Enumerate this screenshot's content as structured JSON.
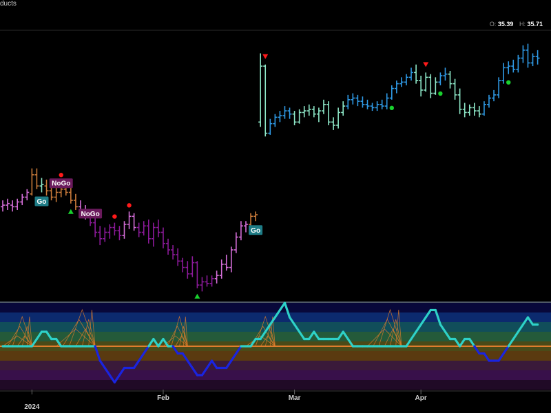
{
  "header": {
    "title_fragment": "ducts",
    "ohlc": [
      {
        "key": "O:",
        "value": "35.39"
      },
      {
        "key": "H:",
        "value": "35.71"
      }
    ]
  },
  "colors": {
    "go_strong": "#2f9ae6",
    "go_weak": "#8ee8c8",
    "nogo_strong": "#8b1a99",
    "nogo_weak": "#d46ed8",
    "amber": "#c97a3a",
    "oscillator_go": "#2ed1c8",
    "oscillator_nogo": "#1a24e0",
    "zero_line": "#e07d2c"
  },
  "chart_data": {
    "type": "bar",
    "title": "",
    "x_ticks": [
      "2024",
      "Feb",
      "Mar",
      "Apr"
    ],
    "tags": [
      {
        "text": "Go",
        "bar": 8
      },
      {
        "text": "NoGo",
        "bar": 12
      },
      {
        "text": "NoGo",
        "bar": 18
      },
      {
        "text": "Go",
        "bar": 52
      }
    ],
    "price_bars": [
      {
        "o": 25.2,
        "h": 25.6,
        "l": 24.9,
        "c": 25.3,
        "s": "nw"
      },
      {
        "o": 25.3,
        "h": 25.7,
        "l": 25.0,
        "c": 25.4,
        "s": "nw"
      },
      {
        "o": 25.3,
        "h": 25.6,
        "l": 24.9,
        "c": 25.2,
        "s": "nw"
      },
      {
        "o": 25.2,
        "h": 25.7,
        "l": 25.0,
        "c": 25.5,
        "s": "nw"
      },
      {
        "o": 25.5,
        "h": 26.0,
        "l": 25.3,
        "c": 25.8,
        "s": "nw"
      },
      {
        "o": 25.8,
        "h": 26.3,
        "l": 25.6,
        "c": 26.1,
        "s": "nw"
      },
      {
        "o": 26.0,
        "h": 27.6,
        "l": 25.9,
        "c": 27.2,
        "s": "a"
      },
      {
        "o": 27.2,
        "h": 27.6,
        "l": 26.3,
        "c": 26.5,
        "s": "a"
      },
      {
        "o": 26.5,
        "h": 27.0,
        "l": 26.1,
        "c": 26.6,
        "s": "gw"
      },
      {
        "o": 26.5,
        "h": 26.9,
        "l": 25.9,
        "c": 26.2,
        "s": "a"
      },
      {
        "o": 26.2,
        "h": 26.6,
        "l": 25.6,
        "c": 25.8,
        "s": "a"
      },
      {
        "o": 25.8,
        "h": 26.4,
        "l": 25.5,
        "c": 26.1,
        "s": "a"
      },
      {
        "o": 26.1,
        "h": 26.8,
        "l": 25.8,
        "c": 26.3,
        "s": "a"
      },
      {
        "o": 26.3,
        "h": 26.6,
        "l": 25.9,
        "c": 26.1,
        "s": "a"
      },
      {
        "o": 26.1,
        "h": 26.4,
        "l": 25.4,
        "c": 25.6,
        "s": "a"
      },
      {
        "o": 25.6,
        "h": 26.0,
        "l": 25.0,
        "c": 25.2,
        "s": "a"
      },
      {
        "o": 25.2,
        "h": 25.6,
        "l": 24.6,
        "c": 24.9,
        "s": "nw"
      },
      {
        "o": 24.9,
        "h": 25.3,
        "l": 24.4,
        "c": 24.6,
        "s": "nw"
      },
      {
        "o": 24.6,
        "h": 24.9,
        "l": 24.0,
        "c": 24.2,
        "s": "ns"
      },
      {
        "o": 24.2,
        "h": 24.6,
        "l": 23.3,
        "c": 23.6,
        "s": "ns"
      },
      {
        "o": 23.6,
        "h": 24.0,
        "l": 22.8,
        "c": 23.2,
        "s": "ns"
      },
      {
        "o": 23.2,
        "h": 23.9,
        "l": 23.0,
        "c": 23.6,
        "s": "ns"
      },
      {
        "o": 23.6,
        "h": 24.1,
        "l": 23.2,
        "c": 23.9,
        "s": "ns"
      },
      {
        "o": 23.9,
        "h": 24.2,
        "l": 23.4,
        "c": 23.7,
        "s": "ns"
      },
      {
        "o": 23.7,
        "h": 24.0,
        "l": 23.1,
        "c": 23.4,
        "s": "ns"
      },
      {
        "o": 23.4,
        "h": 24.3,
        "l": 23.2,
        "c": 24.1,
        "s": "nw"
      },
      {
        "o": 24.1,
        "h": 24.9,
        "l": 23.8,
        "c": 24.6,
        "s": "nw"
      },
      {
        "o": 24.6,
        "h": 24.8,
        "l": 23.7,
        "c": 23.9,
        "s": "nw"
      },
      {
        "o": 23.9,
        "h": 24.2,
        "l": 23.3,
        "c": 23.6,
        "s": "ns"
      },
      {
        "o": 23.6,
        "h": 24.3,
        "l": 23.4,
        "c": 24.0,
        "s": "ns"
      },
      {
        "o": 24.0,
        "h": 24.4,
        "l": 22.9,
        "c": 23.2,
        "s": "ns"
      },
      {
        "o": 23.2,
        "h": 24.2,
        "l": 22.7,
        "c": 23.9,
        "s": "ns"
      },
      {
        "o": 23.9,
        "h": 24.4,
        "l": 23.3,
        "c": 23.6,
        "s": "ns"
      },
      {
        "o": 23.6,
        "h": 23.9,
        "l": 22.6,
        "c": 22.9,
        "s": "ns"
      },
      {
        "o": 22.9,
        "h": 23.2,
        "l": 22.2,
        "c": 22.5,
        "s": "ns"
      },
      {
        "o": 22.5,
        "h": 22.8,
        "l": 21.9,
        "c": 22.2,
        "s": "ns"
      },
      {
        "o": 22.2,
        "h": 22.6,
        "l": 21.5,
        "c": 21.8,
        "s": "ns"
      },
      {
        "o": 21.8,
        "h": 22.0,
        "l": 21.1,
        "c": 21.4,
        "s": "ns"
      },
      {
        "o": 21.4,
        "h": 21.8,
        "l": 20.7,
        "c": 21.0,
        "s": "ns"
      },
      {
        "o": 21.0,
        "h": 22.1,
        "l": 20.8,
        "c": 21.7,
        "s": "ns"
      },
      {
        "o": 21.7,
        "h": 21.8,
        "l": 20.1,
        "c": 20.3,
        "s": "ns"
      },
      {
        "o": 20.3,
        "h": 20.8,
        "l": 19.9,
        "c": 20.5,
        "s": "ns"
      },
      {
        "o": 20.5,
        "h": 20.9,
        "l": 20.2,
        "c": 20.4,
        "s": "ns"
      },
      {
        "o": 20.4,
        "h": 20.9,
        "l": 20.2,
        "c": 20.7,
        "s": "ns"
      },
      {
        "o": 20.7,
        "h": 21.2,
        "l": 20.4,
        "c": 20.9,
        "s": "nw"
      },
      {
        "o": 20.9,
        "h": 21.9,
        "l": 20.7,
        "c": 21.6,
        "s": "nw"
      },
      {
        "o": 21.6,
        "h": 22.2,
        "l": 21.2,
        "c": 21.4,
        "s": "nw"
      },
      {
        "o": 21.4,
        "h": 22.7,
        "l": 21.1,
        "c": 22.5,
        "s": "nw"
      },
      {
        "o": 22.5,
        "h": 23.6,
        "l": 22.3,
        "c": 23.3,
        "s": "nw"
      },
      {
        "o": 23.3,
        "h": 24.3,
        "l": 23.1,
        "c": 24.0,
        "s": "nw"
      },
      {
        "o": 24.0,
        "h": 24.3,
        "l": 23.6,
        "c": 24.1,
        "s": "nw"
      },
      {
        "o": 24.1,
        "h": 24.8,
        "l": 23.9,
        "c": 24.6,
        "s": "a"
      },
      {
        "o": 24.6,
        "h": 24.9,
        "l": 24.3,
        "c": 24.7,
        "s": "a"
      },
      {
        "o": 30.5,
        "h": 34.8,
        "l": 30.2,
        "c": 34.0,
        "s": "gw"
      },
      {
        "o": 34.0,
        "h": 34.1,
        "l": 29.6,
        "c": 29.8,
        "s": "gw"
      },
      {
        "o": 29.8,
        "h": 30.7,
        "l": 29.7,
        "c": 30.4,
        "s": "gs"
      },
      {
        "o": 30.4,
        "h": 31.0,
        "l": 30.2,
        "c": 30.8,
        "s": "gs"
      },
      {
        "o": 30.8,
        "h": 31.2,
        "l": 30.5,
        "c": 30.9,
        "s": "gs"
      },
      {
        "o": 30.9,
        "h": 31.5,
        "l": 30.7,
        "c": 31.2,
        "s": "gs"
      },
      {
        "o": 31.2,
        "h": 31.4,
        "l": 30.7,
        "c": 31.0,
        "s": "gs"
      },
      {
        "o": 31.0,
        "h": 31.2,
        "l": 30.3,
        "c": 30.5,
        "s": "gw"
      },
      {
        "o": 30.5,
        "h": 31.3,
        "l": 30.4,
        "c": 31.1,
        "s": "gw"
      },
      {
        "o": 31.1,
        "h": 31.5,
        "l": 30.8,
        "c": 31.2,
        "s": "gw"
      },
      {
        "o": 31.2,
        "h": 31.6,
        "l": 30.9,
        "c": 31.3,
        "s": "gw"
      },
      {
        "o": 31.3,
        "h": 31.5,
        "l": 30.8,
        "c": 31.0,
        "s": "gw"
      },
      {
        "o": 31.0,
        "h": 31.4,
        "l": 30.5,
        "c": 31.2,
        "s": "gw"
      },
      {
        "o": 31.2,
        "h": 31.9,
        "l": 31.0,
        "c": 31.6,
        "s": "gw"
      },
      {
        "o": 31.6,
        "h": 31.8,
        "l": 30.3,
        "c": 30.5,
        "s": "gw"
      },
      {
        "o": 30.5,
        "h": 30.8,
        "l": 30.0,
        "c": 30.3,
        "s": "gw"
      },
      {
        "o": 30.3,
        "h": 31.4,
        "l": 30.1,
        "c": 31.1,
        "s": "gw"
      },
      {
        "o": 31.1,
        "h": 31.8,
        "l": 30.9,
        "c": 31.5,
        "s": "gw"
      },
      {
        "o": 31.5,
        "h": 32.2,
        "l": 31.3,
        "c": 31.9,
        "s": "gs"
      },
      {
        "o": 31.9,
        "h": 32.3,
        "l": 31.6,
        "c": 32.0,
        "s": "gs"
      },
      {
        "o": 32.0,
        "h": 32.2,
        "l": 31.5,
        "c": 31.8,
        "s": "gs"
      },
      {
        "o": 31.8,
        "h": 32.1,
        "l": 31.4,
        "c": 31.6,
        "s": "gs"
      },
      {
        "o": 31.6,
        "h": 31.9,
        "l": 31.3,
        "c": 31.5,
        "s": "gs"
      },
      {
        "o": 31.5,
        "h": 31.7,
        "l": 31.2,
        "c": 31.4,
        "s": "gs"
      },
      {
        "o": 31.4,
        "h": 31.8,
        "l": 31.2,
        "c": 31.6,
        "s": "gs"
      },
      {
        "o": 31.6,
        "h": 31.9,
        "l": 31.3,
        "c": 31.5,
        "s": "gs"
      },
      {
        "o": 31.5,
        "h": 32.3,
        "l": 31.3,
        "c": 32.0,
        "s": "gs"
      },
      {
        "o": 32.0,
        "h": 32.8,
        "l": 31.9,
        "c": 32.6,
        "s": "gs"
      },
      {
        "o": 32.6,
        "h": 33.1,
        "l": 32.3,
        "c": 32.9,
        "s": "gs"
      },
      {
        "o": 32.9,
        "h": 33.3,
        "l": 32.7,
        "c": 33.0,
        "s": "gs"
      },
      {
        "o": 33.0,
        "h": 33.5,
        "l": 32.8,
        "c": 33.3,
        "s": "gs"
      },
      {
        "o": 33.3,
        "h": 33.9,
        "l": 33.1,
        "c": 33.6,
        "s": "gs"
      },
      {
        "o": 33.6,
        "h": 34.1,
        "l": 32.9,
        "c": 33.1,
        "s": "gw"
      },
      {
        "o": 33.1,
        "h": 33.4,
        "l": 32.1,
        "c": 32.5,
        "s": "gw"
      },
      {
        "o": 32.5,
        "h": 33.6,
        "l": 32.4,
        "c": 33.3,
        "s": "gw"
      },
      {
        "o": 33.3,
        "h": 33.5,
        "l": 32.0,
        "c": 32.3,
        "s": "gw"
      },
      {
        "o": 32.3,
        "h": 33.3,
        "l": 32.2,
        "c": 33.0,
        "s": "gw"
      },
      {
        "o": 33.0,
        "h": 33.6,
        "l": 32.8,
        "c": 33.4,
        "s": "gs"
      },
      {
        "o": 33.4,
        "h": 33.9,
        "l": 33.1,
        "c": 33.5,
        "s": "gs"
      },
      {
        "o": 33.5,
        "h": 33.7,
        "l": 32.6,
        "c": 32.9,
        "s": "gw"
      },
      {
        "o": 32.9,
        "h": 33.2,
        "l": 31.9,
        "c": 32.2,
        "s": "gw"
      },
      {
        "o": 32.2,
        "h": 32.6,
        "l": 31.0,
        "c": 31.3,
        "s": "gw"
      },
      {
        "o": 31.3,
        "h": 31.7,
        "l": 30.8,
        "c": 31.1,
        "s": "gw"
      },
      {
        "o": 31.1,
        "h": 31.6,
        "l": 30.9,
        "c": 31.4,
        "s": "gw"
      },
      {
        "o": 31.4,
        "h": 31.7,
        "l": 30.9,
        "c": 31.2,
        "s": "gw"
      },
      {
        "o": 31.2,
        "h": 31.5,
        "l": 30.8,
        "c": 31.0,
        "s": "gw"
      },
      {
        "o": 31.0,
        "h": 31.8,
        "l": 30.9,
        "c": 31.6,
        "s": "gs"
      },
      {
        "o": 31.6,
        "h": 32.2,
        "l": 31.4,
        "c": 32.0,
        "s": "gs"
      },
      {
        "o": 32.0,
        "h": 32.5,
        "l": 31.8,
        "c": 32.2,
        "s": "gs"
      },
      {
        "o": 32.2,
        "h": 33.3,
        "l": 32.0,
        "c": 33.1,
        "s": "gs"
      },
      {
        "o": 33.1,
        "h": 34.2,
        "l": 32.9,
        "c": 33.9,
        "s": "gs"
      },
      {
        "o": 33.9,
        "h": 34.3,
        "l": 33.5,
        "c": 34.0,
        "s": "gs"
      },
      {
        "o": 34.0,
        "h": 34.4,
        "l": 33.6,
        "c": 33.8,
        "s": "gs"
      },
      {
        "o": 33.8,
        "h": 34.7,
        "l": 33.6,
        "c": 34.5,
        "s": "gs"
      },
      {
        "o": 34.5,
        "h": 35.3,
        "l": 34.2,
        "c": 35.0,
        "s": "gs"
      },
      {
        "o": 35.0,
        "h": 35.4,
        "l": 33.9,
        "c": 34.2,
        "s": "gs"
      },
      {
        "o": 34.2,
        "h": 34.8,
        "l": 34.0,
        "c": 34.6,
        "s": "gs"
      },
      {
        "o": 34.6,
        "h": 35.0,
        "l": 34.1,
        "c": 34.5,
        "s": "gs"
      }
    ],
    "signals": [
      {
        "bar": 23,
        "kind": "dot",
        "color": "#ff1a1a"
      },
      {
        "bar": 26,
        "kind": "dot",
        "color": "#ff1a1a"
      },
      {
        "bar": 14,
        "kind": "up",
        "color": "#19d12e"
      },
      {
        "bar": 12,
        "kind": "dot",
        "color": "#ff1a1a"
      },
      {
        "bar": 40,
        "kind": "up",
        "color": "#19d12e"
      },
      {
        "bar": 54,
        "kind": "down",
        "color": "#ff1a1a"
      },
      {
        "bar": 87,
        "kind": "down",
        "color": "#ff1a1a"
      },
      {
        "bar": 80,
        "kind": "dot",
        "color": "#19d12e"
      },
      {
        "bar": 90,
        "kind": "dot",
        "color": "#19d12e"
      },
      {
        "bar": 104,
        "kind": "dot",
        "color": "#19d12e"
      }
    ],
    "oscillator": {
      "zero": 0,
      "range": [
        -6,
        6
      ],
      "values": [
        0,
        0,
        0,
        0,
        0,
        0,
        0,
        1,
        2,
        2,
        1,
        1,
        0,
        0,
        0,
        0,
        0,
        0,
        0,
        0,
        -2,
        -3,
        -4,
        -5,
        -4,
        -3,
        -3,
        -3,
        -2,
        -1,
        0,
        1,
        0,
        1,
        0,
        0,
        -1,
        -1,
        -2,
        -3,
        -4,
        -4,
        -3,
        -2,
        -3,
        -3,
        -3,
        -2,
        -1,
        0,
        0,
        0,
        1,
        1,
        2,
        3,
        4,
        5,
        6,
        4,
        3,
        2,
        1,
        1,
        2,
        1,
        1,
        1,
        1,
        1,
        2,
        1,
        0,
        0,
        0,
        0,
        0,
        0,
        0,
        0,
        0,
        0,
        0,
        0,
        1,
        2,
        3,
        4,
        5,
        5,
        3,
        2,
        1,
        1,
        0,
        1,
        1,
        0,
        -1,
        -1,
        -2,
        -2,
        -2,
        -1,
        0,
        1,
        2,
        3,
        4,
        3,
        3,
        2,
        1,
        2
      ]
    }
  }
}
